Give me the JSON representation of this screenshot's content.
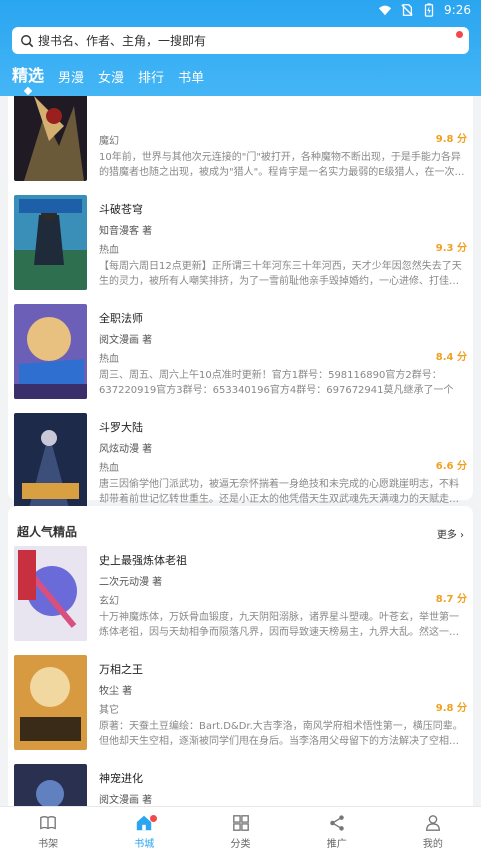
{
  "status": {
    "time": "9:26"
  },
  "search": {
    "placeholder": "搜书名、作者、主角，一搜即有"
  },
  "tabs": [
    {
      "label": "精选",
      "active": true
    },
    {
      "label": "男漫"
    },
    {
      "label": "女漫"
    },
    {
      "label": "排行"
    },
    {
      "label": "书单"
    }
  ],
  "list1": [
    {
      "title": "",
      "author": "",
      "genre": "魔幻",
      "score": "9.8 分",
      "desc": "10年前，世界与其他次元连接的\"门\"被打开，各种魔物不断出现，于是手能力各异的猎魔者也随之出现，被成为\"猎人\"。程肯宇是一名实力最弱的E级猎人，在一次…"
    },
    {
      "title": "斗破苍穹",
      "author": "知音漫客 著",
      "genre": "热血",
      "score": "9.3 分",
      "desc": "【每周六周日12点更新】正所谓三十年河东三十年河西，天才少年因忽然失去了天生的灵力，被所有人嘲笑排挤，为了一雪前耻他亲手毁掉婚约，一心进修、打佳…"
    },
    {
      "title": "全职法师",
      "author": "阅文漫画 著",
      "genre": "热血",
      "score": "8.4 分",
      "desc": "周三、周五、周六上午10点准时更新！官方1群号：598116890官方2群号：637220919官方3群号：653340196官方4群号：697672941莫凡继承了一个神…"
    },
    {
      "title": "斗罗大陆",
      "author": "风炫动漫 著",
      "genre": "热血",
      "score": "6.6 分",
      "desc": "唐三因偷学他门派武功，被逼无奈怀揣着一身绝技和未完成的心愿跳崖明志，不料却带着前世记忆转世重生。还是小正太的他凭借天生双武魂先天满魂力的天赋走…"
    }
  ],
  "section2": {
    "title": "超人气精品",
    "more": "更多"
  },
  "list2": [
    {
      "title": "史上最强炼体老祖",
      "author": "二次元动漫 著",
      "genre": "玄幻",
      "score": "8.7 分",
      "desc": "十万神魔炼体，万妖骨血锻度，九天阴阳溺脉，诸界星斗塑魂。叶苍玄，举世第一炼体老祖，因与天劫相争而陨落凡界，因而导致速天榜易主，九界大乱。然这一…"
    },
    {
      "title": "万相之王",
      "author": "牧尘 著",
      "genre": "其它",
      "score": "9.8 分",
      "desc": "原著：天蚕土豆编绘：Bart.D&Dr.大吉李洛，南风学府相术悟性第一，横压同辈。但他却天生空相，逐渐被同学们甩在身后。当李洛用父母留下的方法解决了空相…"
    },
    {
      "title": "神宠进化",
      "author": "阅文漫画 著",
      "genre": "",
      "score": "",
      "desc": ""
    }
  ],
  "bottom_nav": [
    {
      "label": "书架",
      "icon": "book-open-icon"
    },
    {
      "label": "书城",
      "icon": "home-icon",
      "active": true
    },
    {
      "label": "分类",
      "icon": "grid-icon"
    },
    {
      "label": "推广",
      "icon": "share-icon"
    },
    {
      "label": "我的",
      "icon": "user-icon"
    }
  ],
  "colors": {
    "accent": "#2aa5f0",
    "score": "#f0a020",
    "badge": "#f24848"
  }
}
